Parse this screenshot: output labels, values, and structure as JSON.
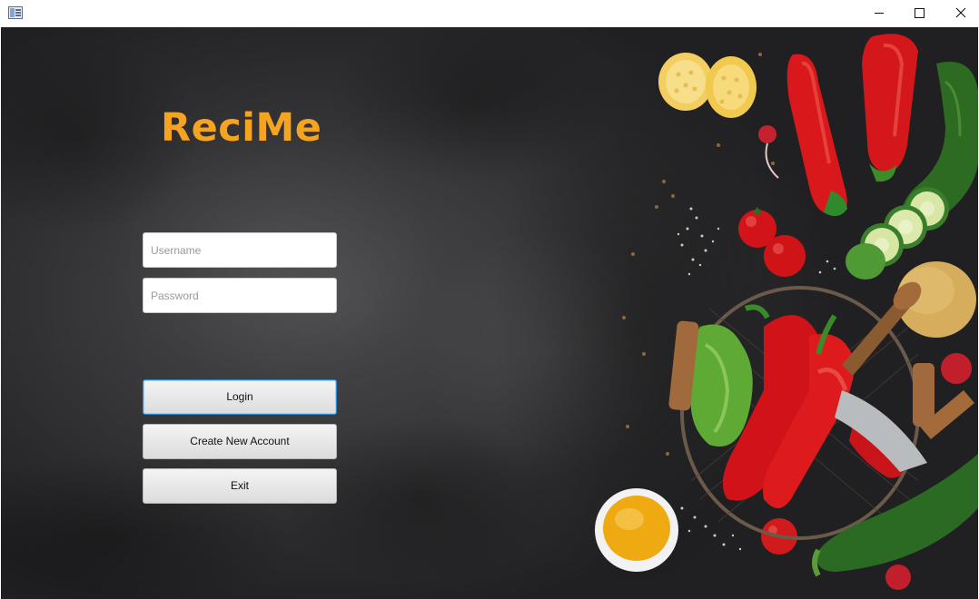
{
  "window": {
    "icon": "app-window-icon"
  },
  "controls": {
    "minimize": "minimize-icon",
    "maximize": "maximize-icon",
    "close": "close-icon"
  },
  "app": {
    "logo_text": "ReciMe"
  },
  "form": {
    "username_placeholder": "Username",
    "password_placeholder": "Password",
    "login_label": "Login",
    "create_label": "Create New Account",
    "exit_label": "Exit"
  },
  "colors": {
    "logo": "#f4a421",
    "focus": "#2a8ad4",
    "background": "#2f2f31"
  }
}
